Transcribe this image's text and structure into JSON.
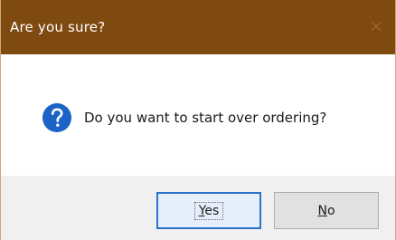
{
  "window": {
    "title": "Are you sure?",
    "close_glyph": "✕"
  },
  "content": {
    "icon": "question-icon",
    "message": "Do you want to start over ordering?"
  },
  "buttons": {
    "yes": {
      "mnemonic": "Y",
      "rest": "es"
    },
    "no": {
      "mnemonic": "N",
      "rest": "o"
    }
  },
  "colors": {
    "titlebar": "#7f4a10",
    "icon": "#1b63c6",
    "default_button_border": "#2b72c9"
  }
}
